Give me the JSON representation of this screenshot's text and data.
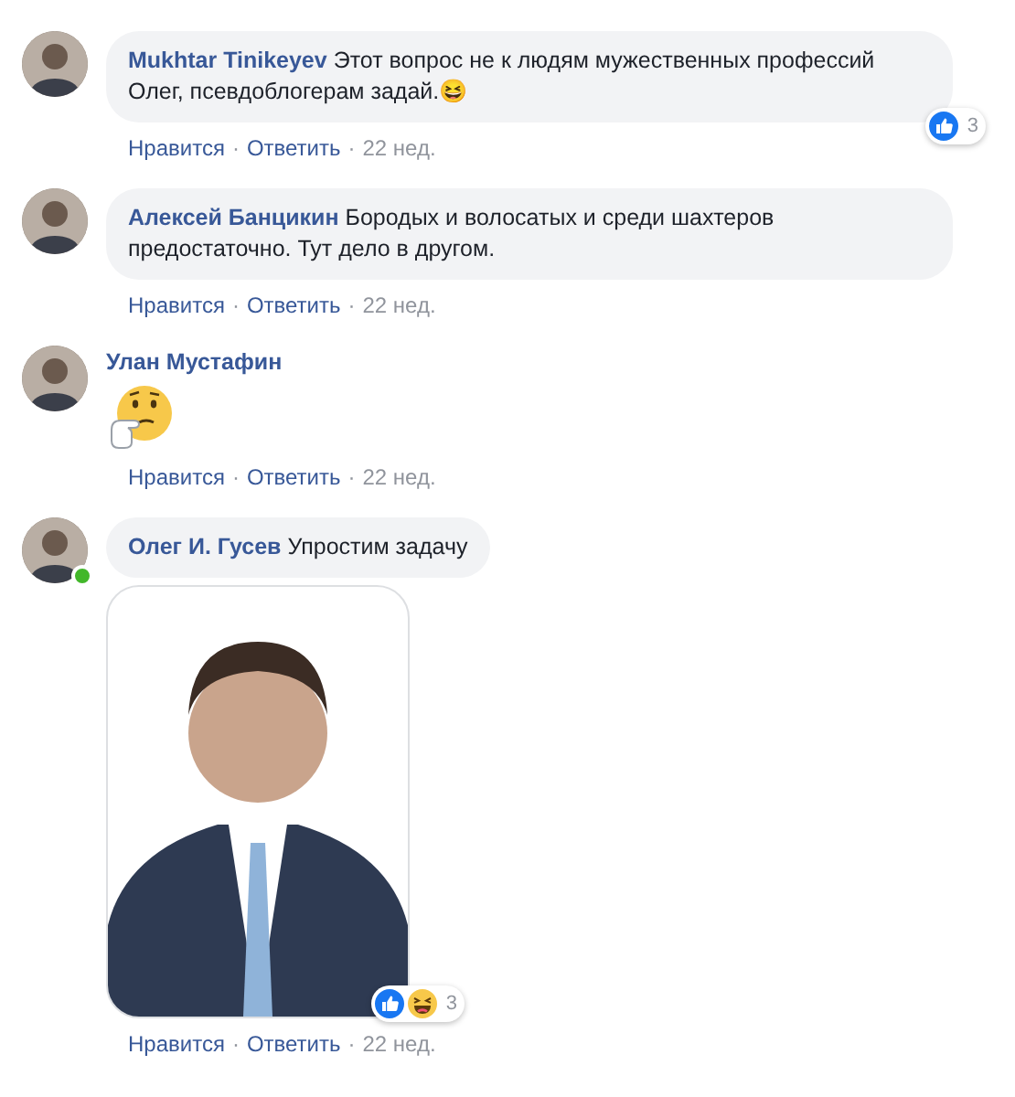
{
  "comments": [
    {
      "author": "Mukhtar Tinikeyev",
      "kind": "text",
      "text": "Этот вопрос не к людям мужественных профессий Олег, псевдоблогерам задай.😆",
      "online": false,
      "reactions": {
        "icons": [
          {
            "kind": "like"
          }
        ],
        "count": "3"
      },
      "actions": {
        "like": "Нравится",
        "separator": "·",
        "reply": "Ответить",
        "time": "22 нед."
      }
    },
    {
      "author": "Алексей Банцикин",
      "kind": "text",
      "text": "Бородых и волосатых и среди шахтеров предостаточно. Тут дело в другом.",
      "online": false,
      "actions": {
        "like": "Нравится",
        "separator": "·",
        "reply": "Ответить",
        "time": "22 нед."
      }
    },
    {
      "author": "Улан Мустафин",
      "kind": "sticker",
      "online": false,
      "actions": {
        "like": "Нравится",
        "separator": "·",
        "reply": "Ответить",
        "time": "22 нед."
      }
    },
    {
      "author": "Олег И. Гусев",
      "kind": "photo",
      "text": "Упростим задачу",
      "online": true,
      "reactions": {
        "icons": [
          {
            "kind": "like"
          },
          {
            "kind": "haha"
          }
        ],
        "count": "3"
      },
      "actions": {
        "like": "Нравится",
        "separator": "·",
        "reply": "Ответить",
        "time": "22 нед."
      }
    }
  ]
}
